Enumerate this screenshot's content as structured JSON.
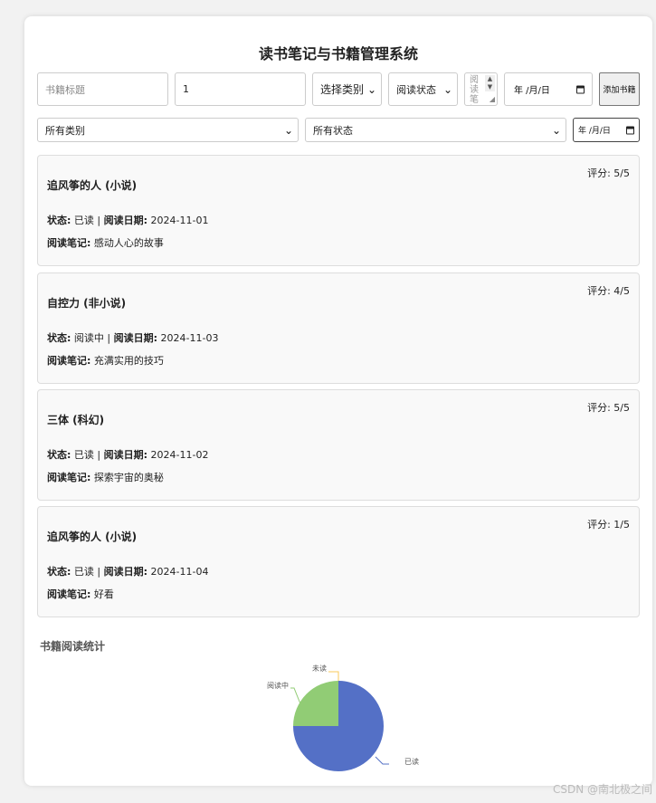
{
  "app": {
    "title": "读书笔记与书籍管理系统"
  },
  "form": {
    "title_placeholder": "书籍标题",
    "rating_value": "1",
    "category_selected": "选择类别",
    "status_selected": "阅读状态",
    "notes_placeholder": "阅读笔记",
    "date_placeholder": "年 /月/日",
    "add_label": "添加书籍"
  },
  "filters": {
    "category_selected": "所有类别",
    "status_selected": "所有状态",
    "date_placeholder": "年 /月/日"
  },
  "labels": {
    "rating_prefix": "评分: ",
    "status_prefix": "状态:",
    "date_prefix": "阅读日期:",
    "note_prefix": "阅读笔记:",
    "separator": "|"
  },
  "books": [
    {
      "title": "追风筝的人 (小说)",
      "rating": "5/5",
      "status": "已读",
      "date": "2024-11-01",
      "note": "感动人心的故事"
    },
    {
      "title": "自控力 (非小说)",
      "rating": "4/5",
      "status": "阅读中",
      "date": "2024-11-03",
      "note": "充满实用的技巧"
    },
    {
      "title": "三体 (科幻)",
      "rating": "5/5",
      "status": "已读",
      "date": "2024-11-02",
      "note": "探索宇宙的奥秘"
    },
    {
      "title": "追风筝的人 (小说)",
      "rating": "1/5",
      "status": "已读",
      "date": "2024-11-04",
      "note": "好看"
    }
  ],
  "stats": {
    "title": "书籍阅读统计"
  },
  "chart_data": {
    "type": "pie",
    "categories": [
      "已读",
      "阅读中",
      "未读"
    ],
    "values": [
      3,
      1,
      0
    ],
    "colors": [
      "#5470c6",
      "#91cc75",
      "#fac858"
    ],
    "label_color": "#555"
  },
  "watermark": "CSDN @南北极之间"
}
